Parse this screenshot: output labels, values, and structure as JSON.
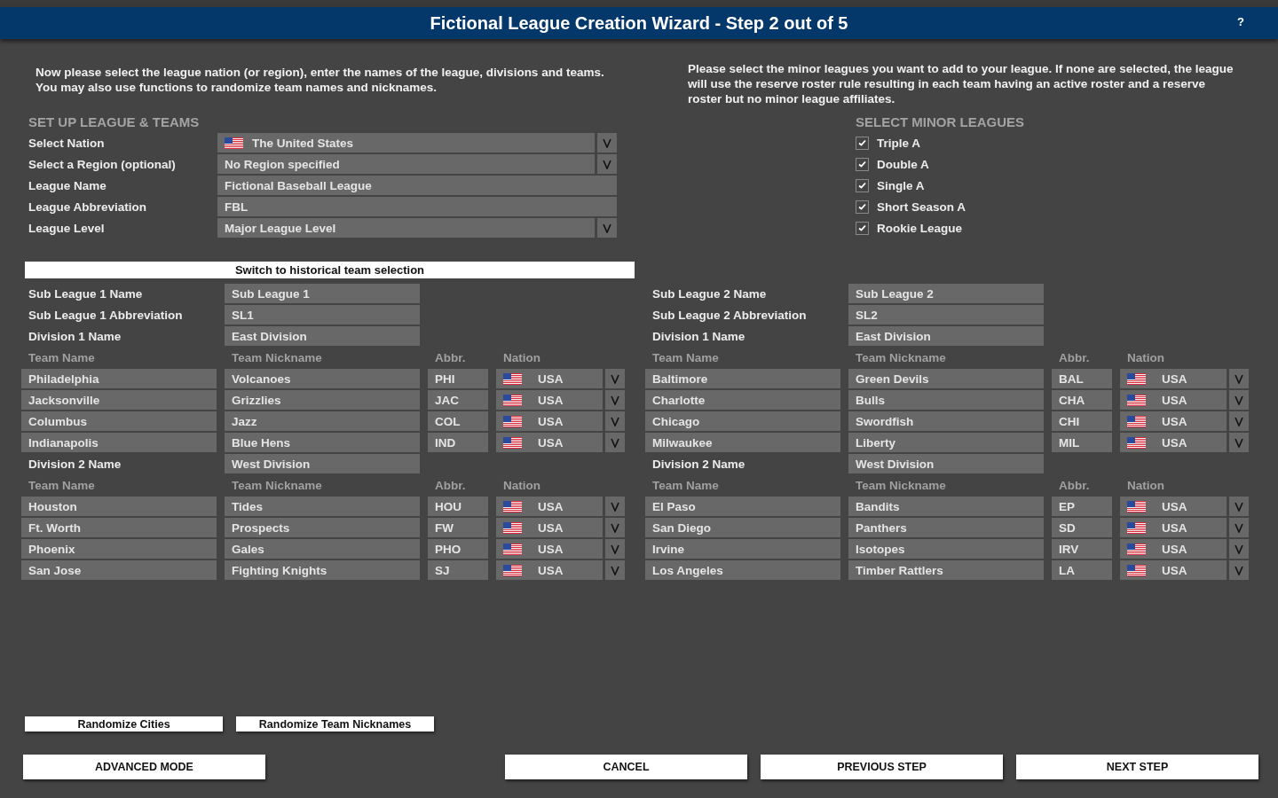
{
  "window": {
    "title": "Fictional League Creation Wizard - Step 2 out of 5",
    "help": "?"
  },
  "setup": {
    "intro": "Now please select the league nation (or region), enter the names of the league, divisions and teams. You may also use functions to randomize team names and nicknames.",
    "heading": "SET UP LEAGUE & TEAMS",
    "fields": [
      {
        "label": "Select Nation",
        "value": "The United States",
        "kind": "nation"
      },
      {
        "label": "Select a Region (optional)",
        "value": "No Region specified",
        "kind": "dropdown"
      },
      {
        "label": "League Name",
        "value": "Fictional Baseball League",
        "kind": "text"
      },
      {
        "label": "League Abbreviation",
        "value": "FBL",
        "kind": "text"
      },
      {
        "label": "League Level",
        "value": "Major League Level",
        "kind": "dropdown"
      }
    ]
  },
  "minor": {
    "intro": "Please select the minor leagues you want to add to your league. If none are selected, the league will use the reserve roster rule resulting in each team having an active roster and a reserve roster but no minor league affiliates.",
    "heading": "SELECT MINOR LEAGUES",
    "leagues": [
      {
        "label": "Triple A",
        "checked": true
      },
      {
        "label": "Double A",
        "checked": true
      },
      {
        "label": "Single A",
        "checked": true
      },
      {
        "label": "Short Season A",
        "checked": true
      },
      {
        "label": "Rookie League",
        "checked": true
      }
    ]
  },
  "switch_button": "Switch to historical team selection",
  "sub_leagues": [
    {
      "fields": [
        {
          "label": "Sub League 1 Name",
          "value": "Sub League 1"
        },
        {
          "label": "Sub League 1 Abbreviation",
          "value": "SL1"
        }
      ],
      "divisions": [
        {
          "label": "Division 1 Name",
          "value": "East Division",
          "columns": [
            "Team Name",
            "Team Nickname",
            "Abbr.",
            "Nation"
          ],
          "teams": [
            {
              "name": "Philadelphia",
              "nickname": "Volcanoes",
              "abbr": "PHI",
              "nation": "USA"
            },
            {
              "name": "Jacksonville",
              "nickname": "Grizzlies",
              "abbr": "JAC",
              "nation": "USA"
            },
            {
              "name": "Columbus",
              "nickname": "Jazz",
              "abbr": "COL",
              "nation": "USA"
            },
            {
              "name": "Indianapolis",
              "nickname": "Blue Hens",
              "abbr": "IND",
              "nation": "USA"
            }
          ]
        },
        {
          "label": "Division 2 Name",
          "value": "West Division",
          "columns": [
            "Team Name",
            "Team Nickname",
            "Abbr.",
            "Nation"
          ],
          "teams": [
            {
              "name": "Houston",
              "nickname": "Tides",
              "abbr": "HOU",
              "nation": "USA"
            },
            {
              "name": "Ft. Worth",
              "nickname": "Prospects",
              "abbr": "FW",
              "nation": "USA"
            },
            {
              "name": "Phoenix",
              "nickname": "Gales",
              "abbr": "PHO",
              "nation": "USA"
            },
            {
              "name": "San Jose",
              "nickname": "Fighting Knights",
              "abbr": "SJ",
              "nation": "USA"
            }
          ]
        }
      ]
    },
    {
      "fields": [
        {
          "label": "Sub League 2 Name",
          "value": "Sub League 2"
        },
        {
          "label": "Sub League 2 Abbreviation",
          "value": "SL2"
        }
      ],
      "divisions": [
        {
          "label": "Division 1 Name",
          "value": "East Division",
          "columns": [
            "Team Name",
            "Team Nickname",
            "Abbr.",
            "Nation"
          ],
          "teams": [
            {
              "name": "Baltimore",
              "nickname": "Green Devils",
              "abbr": "BAL",
              "nation": "USA"
            },
            {
              "name": "Charlotte",
              "nickname": "Bulls",
              "abbr": "CHA",
              "nation": "USA"
            },
            {
              "name": "Chicago",
              "nickname": "Swordfish",
              "abbr": "CHI",
              "nation": "USA"
            },
            {
              "name": "Milwaukee",
              "nickname": "Liberty",
              "abbr": "MIL",
              "nation": "USA"
            }
          ]
        },
        {
          "label": "Division 2 Name",
          "value": "West Division",
          "columns": [
            "Team Name",
            "Team Nickname",
            "Abbr.",
            "Nation"
          ],
          "teams": [
            {
              "name": "El Paso",
              "nickname": "Bandits",
              "abbr": "EP",
              "nation": "USA"
            },
            {
              "name": "San Diego",
              "nickname": "Panthers",
              "abbr": "SD",
              "nation": "USA"
            },
            {
              "name": "Irvine",
              "nickname": "Isotopes",
              "abbr": "IRV",
              "nation": "USA"
            },
            {
              "name": "Los Angeles",
              "nickname": "Timber Rattlers",
              "abbr": "LA",
              "nation": "USA"
            }
          ]
        }
      ]
    }
  ],
  "randomize_buttons": [
    "Randomize Cities",
    "Randomize Team Nicknames"
  ],
  "footer": {
    "left": [
      "ADVANCED MODE"
    ],
    "right": [
      "CANCEL",
      "PREVIOUS STEP",
      "NEXT STEP"
    ]
  }
}
